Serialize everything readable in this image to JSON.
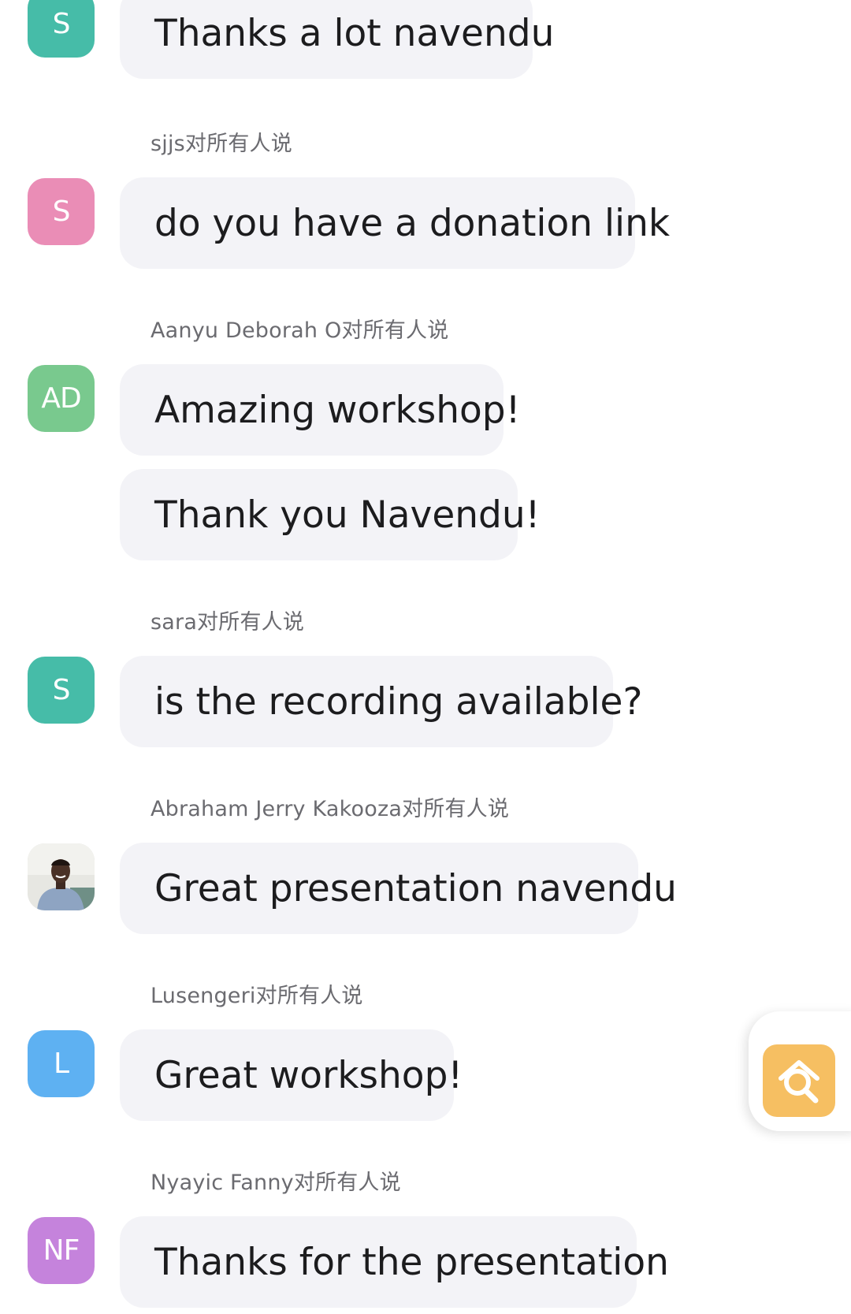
{
  "messages": [
    {
      "sender": "",
      "avatar_text": "S",
      "avatar_color": "#46bca8",
      "bubbles": [
        "Thanks a lot navendu"
      ]
    },
    {
      "sender": "sjjs对所有人说",
      "avatar_text": "S",
      "avatar_color": "#ea8db6",
      "bubbles": [
        "do you have a donation link"
      ]
    },
    {
      "sender": "Aanyu Deborah O对所有人说",
      "avatar_text": "AD",
      "avatar_color": "#79c98e",
      "bubbles": [
        "Amazing workshop!",
        "Thank you Navendu!"
      ]
    },
    {
      "sender": "sara对所有人说",
      "avatar_text": "S",
      "avatar_color": "#46bca8",
      "bubbles": [
        "is the recording available?"
      ]
    },
    {
      "sender": "Abraham Jerry Kakooza对所有人说",
      "avatar_text": "",
      "avatar_icon": "profile-photo",
      "bubbles": [
        "Great presentation navendu"
      ]
    },
    {
      "sender": "Lusengeri对所有人说",
      "avatar_text": "L",
      "avatar_color": "#5eb1f2",
      "bubbles": [
        "Great workshop!"
      ]
    },
    {
      "sender": "Nyayic Fanny对所有人说",
      "avatar_text": "NF",
      "avatar_color": "#c583dc",
      "bubbles": [
        "Thanks for the presentation"
      ]
    }
  ],
  "floating_button": {
    "icon": "search-document-icon",
    "color": "#f6bf62"
  }
}
